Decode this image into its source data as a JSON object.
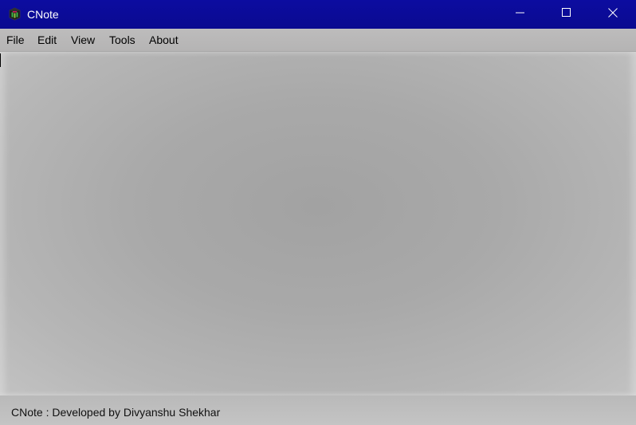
{
  "window": {
    "title": "CNote",
    "title_bar_color": "#0b0b98",
    "icon": "cnote-app-icon",
    "controls": {
      "minimize_icon": "minimize-icon",
      "maximize_icon": "maximize-icon",
      "close_icon": "close-icon"
    }
  },
  "menubar": {
    "items": [
      {
        "label": "File"
      },
      {
        "label": "Edit"
      },
      {
        "label": "View"
      },
      {
        "label": "Tools"
      },
      {
        "label": "About"
      }
    ]
  },
  "editor": {
    "content": ""
  },
  "statusbar": {
    "text": "CNote : Developed by Divyanshu Shekhar"
  }
}
